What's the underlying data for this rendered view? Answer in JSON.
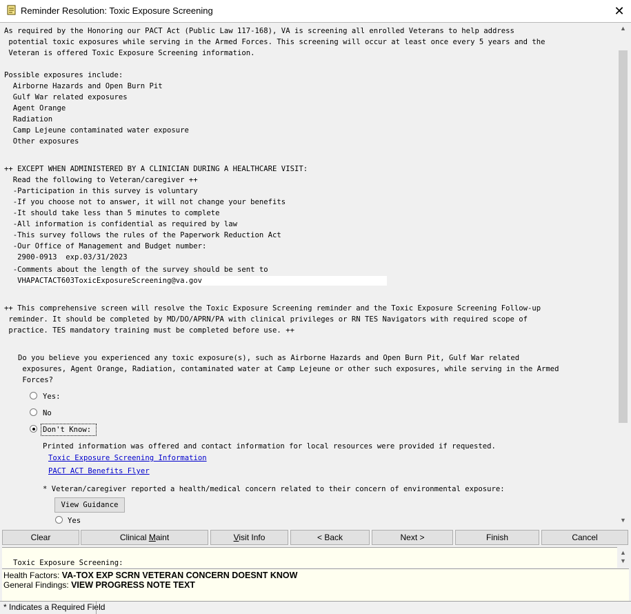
{
  "window": {
    "title": "Reminder Resolution: Toxic Exposure Screening",
    "close_glyph": "✕",
    "app_icon": "notepad-reminder-icon"
  },
  "intro": [
    "As required by the Honoring our PACT Act (Public Law 117-168), VA is screening all enrolled Veterans to help address",
    " potential toxic exposures while serving in the Armed Forces. This screening will occur at least once every 5 years and the",
    " Veteran is offered Toxic Exposure Screening information."
  ],
  "exposures": {
    "heading": "Possible exposures include:",
    "items": [
      "  Airborne Hazards and Open Burn Pit",
      "  Gulf War related exposures",
      "  Agent Orange",
      "  Radiation",
      "  Camp Lejeune contaminated water exposure",
      "  Other exposures"
    ]
  },
  "clinician_notice": [
    "++ EXCEPT WHEN ADMINISTERED BY A CLINICIAN DURING A HEALTHCARE VISIT:",
    "  Read the following to Veteran/caregiver ++",
    "  -Participation in this survey is voluntary",
    "  -If you choose not to answer, it will not change your benefits",
    "  -It should take less than 5 minutes to complete",
    "  -All information is confidential as required by law",
    "  -This survey follows the rules of the Paperwork Reduction Act",
    "  -Our Office of Management and Budget number:",
    "   2900-0913  exp.03/31/2023",
    "  -Comments about the length of the survey should be sent to",
    "   VHAPACTACT603ToxicExposureScreening@va.gov"
  ],
  "resolve_notice": [
    "++ This comprehensive screen will resolve the Toxic Exposure Screening reminder and the Toxic Exposure Screening Follow-up",
    " reminder. It should be completed by MD/DO/APRN/PA with clinical privileges or RN TES Navigators with required scope of",
    " practice. TES mandatory training must be completed before use. ++"
  ],
  "question": [
    "Do you believe you experienced any toxic exposure(s), such as Airborne Hazards and Open Burn Pit, Gulf War related",
    " exposures, Agent Orange, Radiation, contaminated water at Camp Lejeune or other such exposures, while serving in the Armed",
    " Forces?"
  ],
  "options": {
    "yes": "Yes:",
    "no": "No",
    "dont_know": "Don't Know:",
    "selected": "dont_know"
  },
  "dont_know_detail": {
    "printed_info": "Printed information was offered and contact information for local resources were provided if requested.",
    "link1": "Toxic Exposure Screening Information",
    "link2": "PACT ACT Benefits Flyer",
    "concern": "* Veteran/caregiver reported a health/medical concern related to their concern of environmental exposure:",
    "guidance_button": "View Guidance",
    "concern_yes": "Yes"
  },
  "buttons": {
    "clear": "Clear",
    "clinical_maint_pre": "Clinical ",
    "clinical_maint_u": "M",
    "clinical_maint_post": "aint",
    "visit_info_u": "V",
    "visit_info_post": "isit Info",
    "back": "< Back",
    "next": "Next >",
    "finish": "Finish",
    "cancel": "Cancel"
  },
  "preview": {
    "text": "Toxic Exposure Screening:"
  },
  "findings": {
    "health_factors_label": "Health Factors:",
    "health_factors_value": "VA-TOX EXP SCRN VETERAN CONCERN DOESNT KNOW",
    "general_findings_label": "General Findings:",
    "general_findings_value": "VIEW PROGRESS NOTE TEXT"
  },
  "status": {
    "text": "* Indicates a Required Field"
  }
}
